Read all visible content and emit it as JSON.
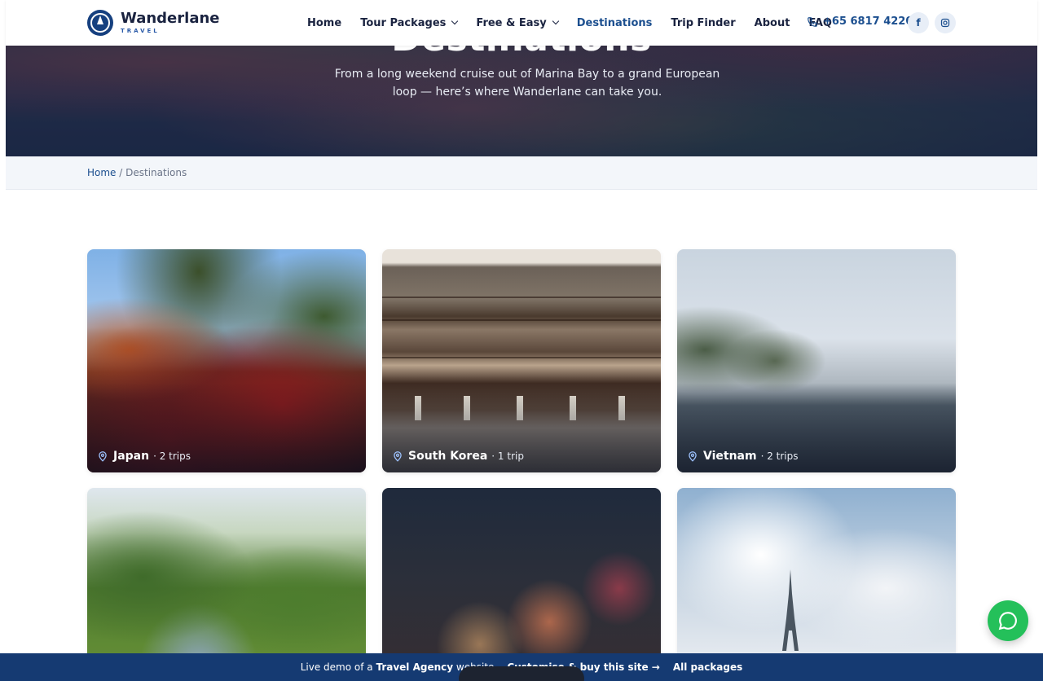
{
  "brand": {
    "name": "Wanderlane",
    "tagline": "TRAVEL"
  },
  "nav": {
    "items": [
      {
        "label": "Home",
        "dropdown": false,
        "active": false
      },
      {
        "label": "Tour Packages",
        "dropdown": true,
        "active": false
      },
      {
        "label": "Free & Easy",
        "dropdown": true,
        "active": false
      },
      {
        "label": "Destinations",
        "dropdown": false,
        "active": true
      },
      {
        "label": "Trip Finder",
        "dropdown": false,
        "active": false
      },
      {
        "label": "About",
        "dropdown": false,
        "active": false
      },
      {
        "label": "FAQ",
        "dropdown": false,
        "active": false
      }
    ],
    "phone": "+65 6817 4220",
    "social": [
      "facebook-icon",
      "instagram-icon"
    ]
  },
  "hero": {
    "title": "Destinations",
    "subtitle": "From a long weekend cruise out of Marina Bay to a grand European loop — here’s where Wanderlane can take you."
  },
  "breadcrumb": {
    "home": "Home",
    "separator": "/",
    "current": "Destinations"
  },
  "destinations": [
    {
      "name": "Japan",
      "trips": "· 2 trips"
    },
    {
      "name": "South Korea",
      "trips": "· 1 trip"
    },
    {
      "name": "Vietnam",
      "trips": "· 2 trips"
    },
    {
      "name": "",
      "trips": ""
    },
    {
      "name": "",
      "trips": ""
    },
    {
      "name": "",
      "trips": ""
    }
  ],
  "bottom_bar": {
    "prefix": "Live demo of a",
    "strong": "Travel Agency",
    "suffix": "website",
    "cta": "Customise & buy this site →",
    "link": "All packages"
  },
  "colors": {
    "primary": "#1c4f8f",
    "dark": "#1a2340",
    "bar": "#153a72",
    "whatsapp": "#24c05a"
  }
}
